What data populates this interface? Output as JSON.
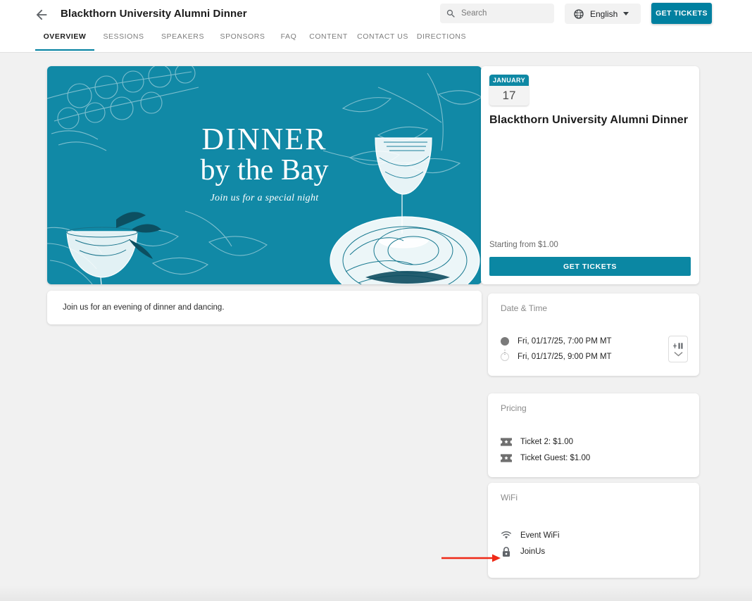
{
  "header": {
    "back_icon": "arrow-left-icon",
    "title": "Blackthorn University Alumni Dinner",
    "search": {
      "placeholder": "Search",
      "value": "",
      "icon": "search-icon"
    },
    "language": {
      "icon": "globe-icon",
      "label": "English",
      "caret": "chevron-down-icon"
    },
    "get_tickets_label": "GET TICKETS"
  },
  "tabs": [
    {
      "label": "OVERVIEW",
      "active": true
    },
    {
      "label": "SESSIONS",
      "active": false
    },
    {
      "label": "SPEAKERS",
      "active": false
    },
    {
      "label": "SPONSORS",
      "active": false
    },
    {
      "label": "FAQ",
      "active": false
    },
    {
      "label": "CONTENT",
      "active": false
    },
    {
      "label": "CONTACT US",
      "active": false
    },
    {
      "label": "DIRECTIONS",
      "active": false
    }
  ],
  "banner": {
    "title": "DINNER",
    "subtitle": "by the Bay",
    "tagline": "Join us for a special night",
    "background_color": "#1189a6"
  },
  "description": {
    "text": "Join us for an evening of dinner and dancing."
  },
  "ticket_card": {
    "date_month": "JANUARY",
    "date_day": "17",
    "title": "Blackthorn University Alumni Dinner",
    "starting_from": "Starting from $1.00",
    "get_tickets_label": "GET TICKETS"
  },
  "date_time_card": {
    "title": "Date & Time",
    "start": "Fri, 01/17/25, 7:00 PM MT",
    "end": "Fri, 01/17/25, 9:00 PM MT",
    "add_to_calendar_icon": "add-to-calendar-icon"
  },
  "pricing_card": {
    "title": "Pricing",
    "items": [
      {
        "icon": "ticket-icon",
        "label": "Ticket 2: $1.00"
      },
      {
        "icon": "ticket-icon",
        "label": "Ticket Guest: $1.00"
      }
    ]
  },
  "wifi_card": {
    "title": "WiFi",
    "items": [
      {
        "icon": "wifi-icon",
        "label": "Event WiFi"
      },
      {
        "icon": "lock-icon",
        "label": "JoinUs"
      }
    ]
  },
  "annotation": {
    "arrow_color": "#ef2a17",
    "points_to": "WiFi"
  },
  "colors": {
    "accent_teal": "#0080a0",
    "banner_teal": "#1189a6",
    "page_background": "#f1f1f1",
    "card_background": "#ffffff"
  }
}
